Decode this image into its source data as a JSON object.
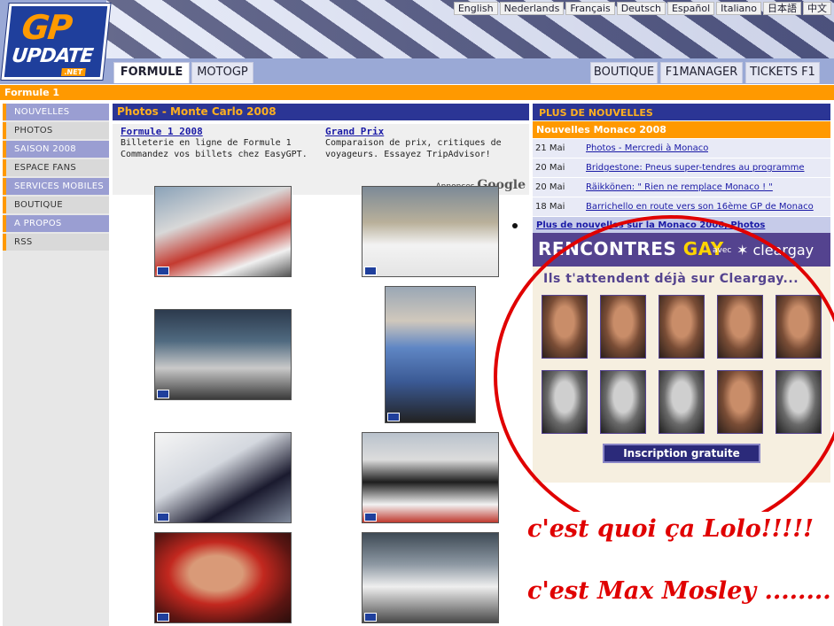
{
  "languages": [
    "English",
    "Nederlands",
    "Français",
    "Deutsch",
    "Español",
    "Italiano",
    "日本語",
    "中文"
  ],
  "logo": {
    "gp": "GP",
    "update": "UPDATE",
    "net": ".NET"
  },
  "tabs_left": [
    "FORMULE 1",
    "MOTOGP"
  ],
  "tabs_right": [
    "BOUTIQUE",
    "F1MANAGER",
    "TICKETS F1"
  ],
  "section_bar": "Formule 1",
  "sidebar": [
    "NOUVELLES",
    "PHOTOS",
    "SAISON 2008",
    "ESPACE FANS",
    "SERVICES MOBILES",
    "BOUTIQUE",
    "A PROPOS",
    "RSS"
  ],
  "main": {
    "title": "Photos - Monte Carlo 2008",
    "ads": [
      {
        "title": "Formule 1 2008",
        "line1": "Billeterie en ligne de Formule 1",
        "line2": "Commandez vos billets chez EasyGPT."
      },
      {
        "title": "Grand Prix",
        "line1": "Comparaison de prix, critiques de",
        "line2": "voyageurs. Essayez TripAdvisor!"
      }
    ],
    "ads_label": "Annonces",
    "ads_brand": "Google"
  },
  "right": {
    "more_title": "PLUS DE NOUVELLES",
    "monaco_title": "Nouvelles Monaco 2008",
    "news": [
      {
        "date": "21 Mai",
        "title": "Photos - Mercredi à Monaco"
      },
      {
        "date": "20 Mai",
        "title": "Bridgestone: Pneus super-tendres au programme"
      },
      {
        "date": "20 Mai",
        "title": "Räikkönen: \" Rien ne remplace Monaco ! \""
      },
      {
        "date": "18 Mai",
        "title": "Barrichello en route vers son 16ème GP de Monaco"
      }
    ],
    "more_link": "Plus de nouvelles sur la Monaco 2008, Photos"
  },
  "gay_ad": {
    "title1": "RENCONTRES",
    "title2": "GAY",
    "avec": "avec",
    "brand": "cleargay",
    "subtitle": "Ils t'attendent déjà sur Cleargay...",
    "button": "Inscription gratuite"
  },
  "annotations": [
    "c'est quoi ça Lolo!!!!!",
    "c'est Max Mosley ........"
  ],
  "colors": {
    "accent_orange": "#ff9900",
    "nav_blue": "#2b3595",
    "annotation_red": "#e00000"
  }
}
